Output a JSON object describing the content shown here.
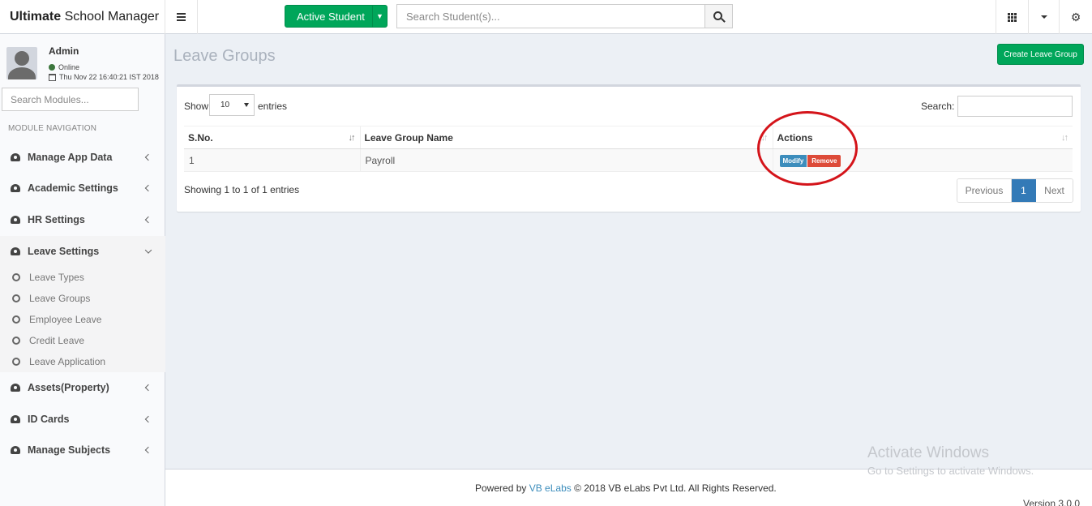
{
  "app": {
    "title_bold": "Ultimate",
    "title_rest": " School Manager"
  },
  "topbar": {
    "active_student_label": "Active Student",
    "student_search_placeholder": "Search Student(s)..."
  },
  "user": {
    "name": "Admin",
    "status": "Online",
    "timestamp": "Thu Nov 22 16:40:21 IST 2018"
  },
  "sidebar": {
    "search_placeholder": "Search Modules...",
    "header": "MODULE NAVIGATION",
    "items": [
      {
        "label": "Manage App Data"
      },
      {
        "label": "Academic Settings"
      },
      {
        "label": "HR Settings"
      },
      {
        "label": "Leave Settings"
      },
      {
        "label": "Assets(Property)"
      },
      {
        "label": "ID Cards"
      },
      {
        "label": "Manage Subjects"
      }
    ],
    "leave_subitems": [
      {
        "label": "Leave Types"
      },
      {
        "label": "Leave Groups"
      },
      {
        "label": "Employee Leave"
      },
      {
        "label": "Credit Leave"
      },
      {
        "label": "Leave Application"
      }
    ]
  },
  "main": {
    "page_title": "Leave Groups",
    "create_button": "Create Leave Group",
    "show_label": "Show",
    "entries_value": "10",
    "entries_label": "entries",
    "search_label": "Search:",
    "columns": [
      "S.No.",
      "Leave Group Name",
      "Actions"
    ],
    "rows": [
      {
        "sno": "1",
        "name": "Payroll",
        "modify": "Modify",
        "remove": "Remove"
      }
    ],
    "info": "Showing 1 to 1 of 1 entries",
    "pagination": {
      "previous": "Previous",
      "current": "1",
      "next": "Next"
    }
  },
  "footer": {
    "powered_by": "Powered by",
    "company_link": "VB eLabs",
    "copyright": "© 2018 VB eLabs Pvt Ltd. All Rights Reserved.",
    "version": "Version 3.0.0"
  },
  "watermark": {
    "line1": "Activate Windows",
    "line2": "Go to Settings to activate Windows."
  },
  "colors": {
    "green": "#00a65a",
    "blue": "#3c8dbc",
    "red": "#dd4b39",
    "annotation": "#d4141a"
  },
  "icons": [
    "hamburger-icon",
    "search-icon",
    "apps-grid-icon",
    "caret-down-icon",
    "gears-icon",
    "dashboard-icon",
    "circle-icon",
    "calendar-icon",
    "user-avatar-icon"
  ]
}
